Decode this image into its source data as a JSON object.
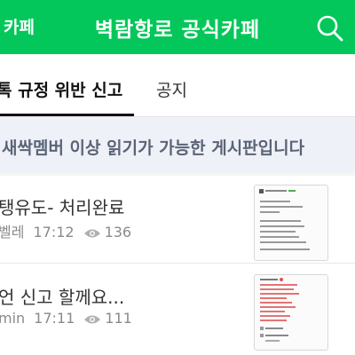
{
  "header": {
    "left_label": "카페",
    "cafe_title": "벽람항로 공식카페",
    "icons": {
      "search": "search-icon"
    }
  },
  "tabs": [
    {
      "label": "톡 규정 위반 신고",
      "active": true
    },
    {
      "label": "공지",
      "active": false
    }
  ],
  "notice": {
    "text": "새싹멤버 이상 읽기가 가능한 게시판입니다"
  },
  "posts": [
    {
      "title": "탱유도- 처리완료",
      "author": "벨레",
      "time": "17:12",
      "views": "136",
      "icon": "eye-icon"
    },
    {
      "title": "언 신고 할께요...",
      "author": "min",
      "time": "17:11",
      "views": "111",
      "icon": "eye-icon"
    }
  ],
  "colors": {
    "brand": "#03c75a",
    "notice_bg": "#eef1f8",
    "meta": "#8a8a8a"
  }
}
